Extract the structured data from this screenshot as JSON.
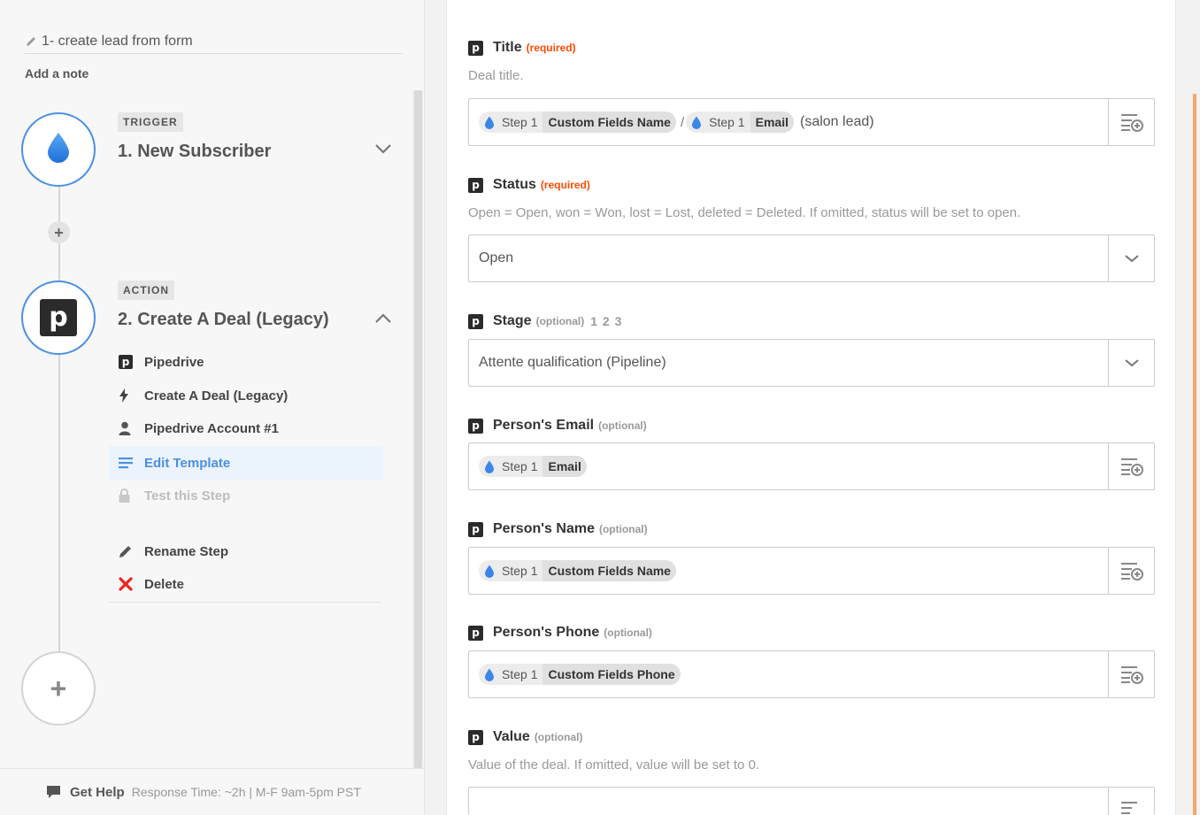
{
  "zap": {
    "name": "1- create lead from form",
    "add_note": "Add a note"
  },
  "trigger": {
    "badge": "TRIGGER",
    "title": "1. New Subscriber"
  },
  "action": {
    "badge": "ACTION",
    "title": "2. Create A Deal (Legacy)",
    "menu": [
      {
        "label": "Pipedrive",
        "icon": "pipedrive-logo-icon"
      },
      {
        "label": "Create A Deal (Legacy)",
        "icon": "lightning-bolt-icon"
      },
      {
        "label": "Pipedrive Account #1",
        "icon": "user-icon"
      },
      {
        "label": "Edit Template",
        "icon": "list-lines-icon"
      },
      {
        "label": "Test this Step",
        "icon": "lock-icon"
      }
    ],
    "rename": "Rename Step",
    "delete": "Delete"
  },
  "help": {
    "label": "Get Help",
    "response_time": "Response Time: ~2h | M-F 9am-5pm PST"
  },
  "fields": {
    "title": {
      "label": "Title",
      "qualifier": "(required)",
      "help": "Deal title.",
      "tokens": [
        {
          "step": "Step 1",
          "field": "Custom Fields  Name"
        },
        {
          "step": "Step 1",
          "field": "Email"
        }
      ],
      "separator": "/",
      "tail": "(salon lead)"
    },
    "status": {
      "label": "Status",
      "qualifier": "(required)",
      "help": "Open = Open, won = Won, lost = Lost, deleted = Deleted. If omitted, status will be set to open.",
      "value": "Open"
    },
    "stage": {
      "label": "Stage",
      "qualifier": "(optional)",
      "nums": "1 2 3",
      "value": "Attente qualification (Pipeline)"
    },
    "person_email": {
      "label": "Person's Email",
      "qualifier": "(optional)",
      "token": {
        "step": "Step 1",
        "field": "Email"
      }
    },
    "person_name": {
      "label": "Person's Name",
      "qualifier": "(optional)",
      "token": {
        "step": "Step 1",
        "field": "Custom Fields  Name"
      }
    },
    "person_phone": {
      "label": "Person's Phone",
      "qualifier": "(optional)",
      "token": {
        "step": "Step 1",
        "field": "Custom Fields  Phone"
      }
    },
    "value": {
      "label": "Value",
      "qualifier": "(optional)",
      "help": "Value of the deal. If omitted, value will be set to 0."
    }
  },
  "colors": {
    "accent": "#4a90e2",
    "required": "#ff4a00",
    "delete": "#e8261e",
    "scroll": "#f4a76b"
  }
}
